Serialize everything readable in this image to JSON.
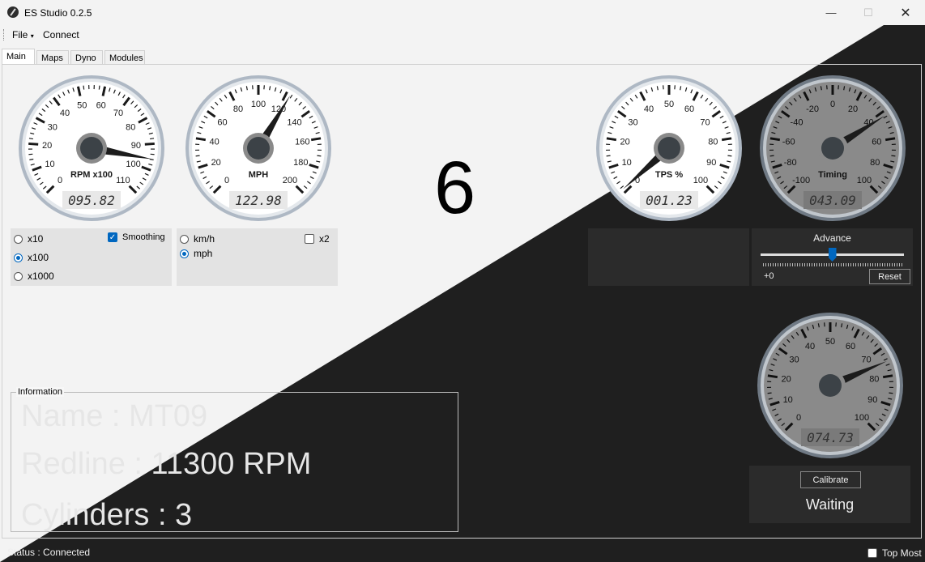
{
  "window": {
    "title": "ES Studio 0.2.5",
    "controls": {
      "minimize": "—",
      "maximize": "☐",
      "close": "✕"
    }
  },
  "menu": {
    "file": "File",
    "file_arrow": "▾",
    "connect": "Connect"
  },
  "tabs": [
    {
      "label": "Main",
      "active": true
    },
    {
      "label": "Maps",
      "active": false
    },
    {
      "label": "Dyno",
      "active": false
    },
    {
      "label": "Modules",
      "active": false
    }
  ],
  "gauges": {
    "rpm": {
      "label": "RPM x100",
      "ticks": [
        "0",
        "10",
        "20",
        "30",
        "40",
        "50",
        "60",
        "70",
        "80",
        "90",
        "100",
        "110"
      ],
      "readout": "095.82",
      "value": 95.82,
      "min": 0,
      "max": 110
    },
    "speed": {
      "label": "MPH",
      "ticks": [
        "0",
        "20",
        "40",
        "60",
        "80",
        "100",
        "120",
        "140",
        "160",
        "180",
        "200"
      ],
      "readout": "122.98",
      "value": 122.98,
      "min": 0,
      "max": 200
    },
    "tps": {
      "label": "TPS %",
      "ticks": [
        "0",
        "10",
        "20",
        "30",
        "40",
        "50",
        "60",
        "70",
        "80",
        "90",
        "100"
      ],
      "readout": "001.23",
      "value": 1.23,
      "min": 0,
      "max": 100
    },
    "timing": {
      "label": "Timing",
      "ticks": [
        "-100",
        "-80",
        "-60",
        "-40",
        "-20",
        "0",
        "20",
        "40",
        "60",
        "80",
        "100"
      ],
      "readout": "043.09",
      "value": 43.09,
      "min": -100,
      "max": 100
    },
    "aux": {
      "label": "",
      "ticks": [
        "0",
        "10",
        "20",
        "30",
        "40",
        "50",
        "60",
        "70",
        "80",
        "90",
        "100"
      ],
      "readout": "074.73",
      "value": 74.73,
      "min": 0,
      "max": 100
    }
  },
  "rpm_options": {
    "x10": "x10",
    "x100": "x100",
    "x1000": "x1000",
    "selected": "x100",
    "smoothing": "Smoothing",
    "smoothing_checked": true
  },
  "speed_options": {
    "kmh": "km/h",
    "mph": "mph",
    "selected": "mph",
    "x2": "x2",
    "x2_checked": false
  },
  "gear": "6",
  "advance": {
    "title": "Advance",
    "value_text": "+0",
    "reset": "Reset",
    "slider_value": 0.5
  },
  "calibrate": {
    "button": "Calibrate",
    "status": "Waiting"
  },
  "information": {
    "legend": "Information",
    "name": "Name : MT09",
    "redline": "Redline : 11300 RPM",
    "cylinders": "Cylinders : 3"
  },
  "status": {
    "text": "Status : Connected",
    "top_most": "Top Most",
    "top_most_checked": false
  }
}
